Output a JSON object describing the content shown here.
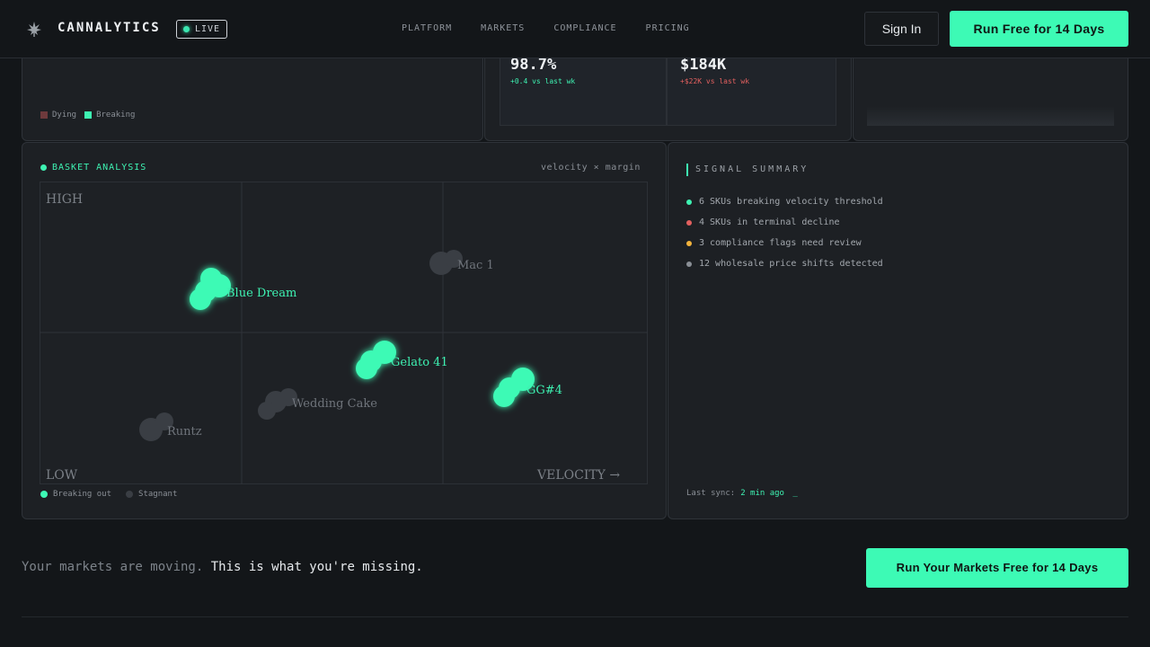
{
  "nav": {
    "brand": "CANNALYTICS",
    "live_badge": "LIVE",
    "links": [
      "PLATFORM",
      "MARKETS",
      "COMPLIANCE",
      "PRICING"
    ],
    "sign_in": "Sign In",
    "cta": "Run Free for 14 Days",
    "icons": {
      "logo": "cannabis-leaf-icon"
    }
  },
  "top_panels": {
    "legend": [
      "Dying",
      "Breaking"
    ],
    "stats": [
      {
        "value": "98.7%",
        "delta": "+0.4 vs last wk",
        "delta_color": "#3ef2b2"
      },
      {
        "value": "$184K",
        "delta": "+$22K vs last wk",
        "delta_color": "#e2605f"
      }
    ]
  },
  "basket": {
    "title": "BASKET ANALYSIS",
    "subtitle": "velocity × margin",
    "quadrant_labels": {
      "high": "HIGH",
      "low": "LOW",
      "velocity": "VELOCITY →"
    },
    "points": [
      {
        "name": "Blue Dream",
        "status": "breaking"
      },
      {
        "name": "Mac 1",
        "status": "stagnant"
      },
      {
        "name": "Gelato 41",
        "status": "breaking"
      },
      {
        "name": "GG#4",
        "status": "breaking"
      },
      {
        "name": "Wedding Cake",
        "status": "stagnant"
      },
      {
        "name": "Runtz",
        "status": "stagnant"
      }
    ],
    "legend": [
      "Breaking out",
      "Stagnant"
    ],
    "colors": {
      "breaking": "#3dfab5",
      "stagnant": "#3a3e44",
      "dying": "#b84a4a"
    }
  },
  "signals": {
    "title": "SIGNAL SUMMARY",
    "items": [
      {
        "text": "6 SKUs breaking velocity threshold",
        "color": "#3ef2b2"
      },
      {
        "text": "4 SKUs in terminal decline",
        "color": "#e2605f"
      },
      {
        "text": "3 compliance flags need review",
        "color": "#f2b33d"
      },
      {
        "text": "12 wholesale price shifts detected",
        "color": "#8a8f96"
      }
    ],
    "last_sync_label": "Last sync:",
    "last_sync_value": "2 min ago",
    "cursor": "_"
  },
  "footer": {
    "tagline_muted": "Your markets are moving.",
    "tagline_strong": "This is what you're missing.",
    "cta": "Run Your Markets Free for 14 Days"
  }
}
